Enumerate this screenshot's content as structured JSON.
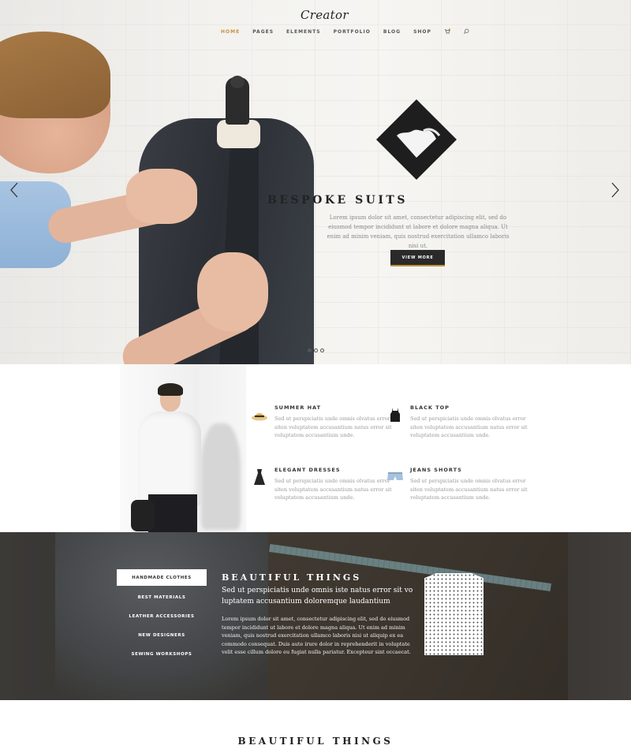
{
  "header": {
    "logo": "Creator",
    "nav": [
      "HOME",
      "PAGES",
      "ELEMENTS",
      "PORTFOLIO",
      "BLOG",
      "SHOP"
    ],
    "active_nav": "HOME",
    "accent_color": "#c7923e",
    "icons": [
      "cart-icon",
      "search-icon"
    ]
  },
  "hero": {
    "title": "BESPOKE SUITS",
    "text": "Lorem ipsum dolor sit amet, consectetur adipiscing elit, sed do eiusmod tempor incididunt ut labore et dolore magna aliqua. Ut enim ad minim veniam, quis nostrud exercitation ullamco laboris nisi ut.",
    "button": "VIEW MORE",
    "slides": 3,
    "active_slide": 1
  },
  "products": [
    {
      "name": "SUMMER HAT",
      "text": "Sed ut perspiciatis unde omnis olvatus error siten voluptatem accusantium natus error sit voluptatem accusantium unde.",
      "icon": "hat-icon"
    },
    {
      "name": "BLACK TOP",
      "text": "Sed ut perspiciatis unde omnis olvatus error siten voluptatem accusantium natus error sit voluptatem accusantium unde.",
      "icon": "top-icon"
    },
    {
      "name": "ELEGANT DRESSES",
      "text": "Sed ut perspiciatis unde omnis olvatus error siten voluptatem accusantium natus error sit voluptatem accusantium unde.",
      "icon": "dress-icon"
    },
    {
      "name": "JEANS SHORTS",
      "text": "Sed ut perspiciatis unde omnis olvatus error siten voluptatem accusantium natus error sit voluptatem accusantium unde.",
      "icon": "shorts-icon"
    }
  ],
  "categories": {
    "items": [
      "HANDMADE CLOTHES",
      "BEST MATERIALS",
      "LEATHER ACCESSORIES",
      "NEW DESIGNERS",
      "SEWING WORKSHOPS"
    ],
    "active": "HANDMADE CLOTHES",
    "title": "BEAUTIFUL THINGS",
    "subtitle": "Sed ut perspiciatis unde omnis iste natus error sit vo luptatem accusantium doloremque laudantium",
    "text": "Lorem ipsum dolor sit amet, consectetur adipiscing elit, sed do eiusmod tempor incididunt ut labore et dolore magna aliqua. Ut enim ad minim veniam, quis nostrud exercitation ullamco laboris nisi ut aliquip ex ea commodo consequat. Duis aute irure dolor in reprehenderit in voluptate velit esse cillum dolore eu fugiat nulla pariatur. Excepteur sint occaecat."
  },
  "footer_section": {
    "title": "BEAUTIFUL THINGS"
  }
}
